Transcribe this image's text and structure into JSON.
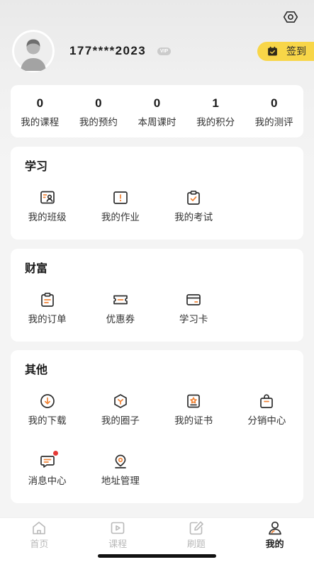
{
  "header": {
    "settings_icon": "settings-icon",
    "avatar_icon": "avatar-icon",
    "phone": "177****2023",
    "vip_badge": "VIP",
    "checkin": {
      "icon": "calendar-icon",
      "label": "签到"
    }
  },
  "stats": [
    {
      "value": "0",
      "label": "我的课程"
    },
    {
      "value": "0",
      "label": "我的预约"
    },
    {
      "value": "0",
      "label": "本周课时"
    },
    {
      "value": "1",
      "label": "我的积分"
    },
    {
      "value": "0",
      "label": "我的测评"
    }
  ],
  "sections": [
    {
      "title": "学习",
      "items": [
        {
          "label": "我的班级",
          "icon": "class-icon"
        },
        {
          "label": "我的作业",
          "icon": "homework-icon"
        },
        {
          "label": "我的考试",
          "icon": "exam-icon"
        }
      ]
    },
    {
      "title": "财富",
      "items": [
        {
          "label": "我的订单",
          "icon": "order-icon"
        },
        {
          "label": "优惠券",
          "icon": "coupon-icon"
        },
        {
          "label": "学习卡",
          "icon": "study-card-icon"
        }
      ]
    },
    {
      "title": "其他",
      "items": [
        {
          "label": "我的下载",
          "icon": "download-icon"
        },
        {
          "label": "我的圈子",
          "icon": "circle-icon"
        },
        {
          "label": "我的证书",
          "icon": "certificate-icon"
        },
        {
          "label": "分销中心",
          "icon": "shopping-bag-icon"
        },
        {
          "label": "消息中心",
          "icon": "message-icon",
          "badge_icon": "unread-dot-icon"
        },
        {
          "label": "地址管理",
          "icon": "location-icon"
        }
      ]
    }
  ],
  "tabbar": [
    {
      "label": "首页",
      "icon": "home-icon",
      "active": false
    },
    {
      "label": "课程",
      "icon": "play-icon",
      "active": false
    },
    {
      "label": "刷题",
      "icon": "edit-icon",
      "active": false
    },
    {
      "label": "我的",
      "icon": "user-icon",
      "active": true
    }
  ],
  "colors": {
    "page_background": "#f4f4f4",
    "card_background": "#ffffff",
    "checkin_yellow": "#f8d648",
    "icon_stroke": "#2e2e2e",
    "icon_accent": "#f08437",
    "unread_dot": "#e53935",
    "tab_inactive": "#b9b9b9",
    "tab_active": "#1f1f1f"
  }
}
